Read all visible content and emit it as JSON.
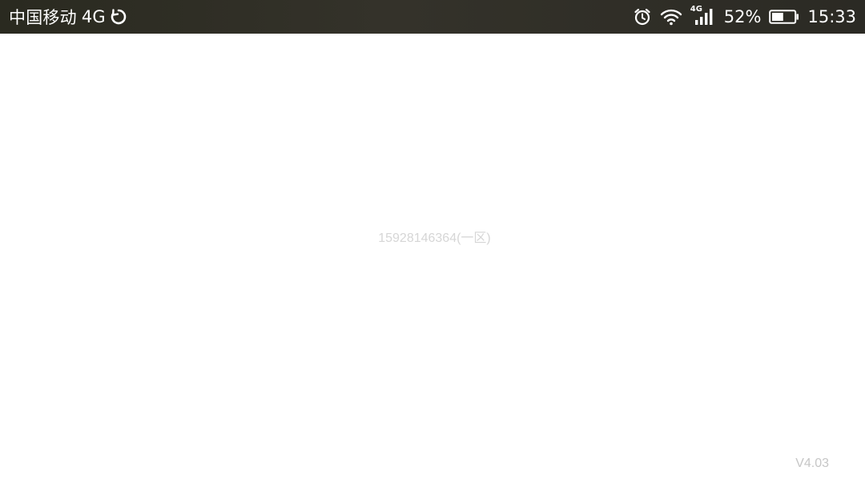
{
  "status_bar": {
    "carrier": "中国移动",
    "network_type": "4G",
    "sync_icon": "sync-icon",
    "alarm_icon": "alarm-clock-icon",
    "wifi_icon": "wifi-icon",
    "signal_icon": "cellular-signal-icon",
    "signal_label": "4G",
    "battery_percent": "52%",
    "battery_icon": "battery-icon",
    "battery_level": 0.52,
    "time": "15:33"
  },
  "main": {
    "account_label": "15928146364(一区)",
    "version": "V4.03"
  }
}
